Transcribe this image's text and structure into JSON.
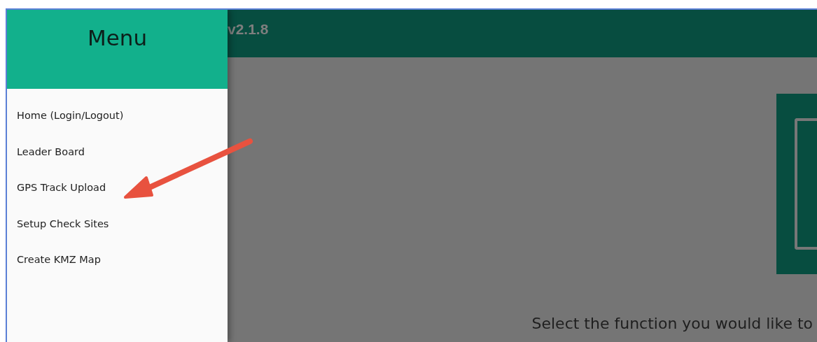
{
  "app_bar": {
    "version": "v2.1.8"
  },
  "menu": {
    "title": "Menu",
    "items": [
      {
        "label": "Home (Login/Logout)"
      },
      {
        "label": "Leader Board"
      },
      {
        "label": "GPS Track Upload"
      },
      {
        "label": "Setup Check Sites"
      },
      {
        "label": "Create KMZ Map"
      }
    ]
  },
  "main": {
    "prompt": "Select the function you would like to"
  }
}
